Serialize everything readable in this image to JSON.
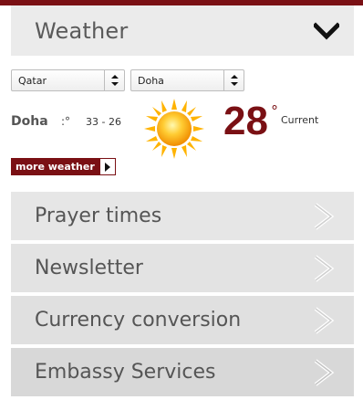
{
  "weather": {
    "title": "Weather",
    "country": "Qatar",
    "city_select": "Doha",
    "city": "Doha",
    "degree_separator": ":°",
    "range": "33 - 26",
    "current_temp": "28",
    "degree_mark": "°",
    "current_label": "Current",
    "more_label": "more weather"
  },
  "menu": [
    {
      "label": "Prayer times"
    },
    {
      "label": "Newsletter"
    },
    {
      "label": "Currency conversion"
    },
    {
      "label": "Embassy Services"
    }
  ],
  "colors": {
    "accent": "#7a1014",
    "panel_bg": "#ebebeb",
    "text": "#555555"
  },
  "icons": {
    "header_toggle": "chevron-down-icon",
    "weather": "sun-icon",
    "menu_arrow": "chevron-right-icon"
  }
}
